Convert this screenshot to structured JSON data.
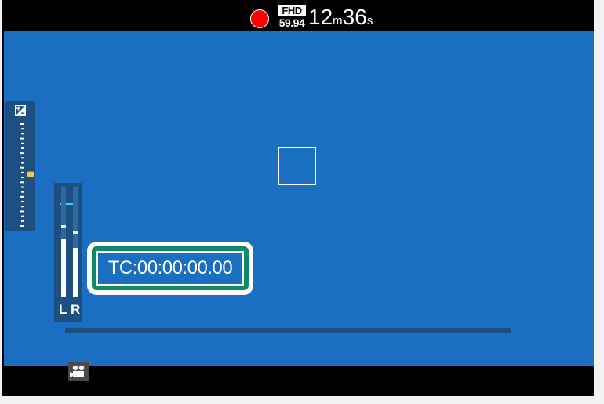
{
  "status": {
    "recording_indicator": "rec-dot",
    "format": "FHD",
    "frame_rate": "59.94",
    "remaining_big": "12",
    "remaining_unit_m": "m",
    "remaining_big_2": "36",
    "remaining_unit_s": "s"
  },
  "timecode": "TC:00:00:00.00",
  "audio": {
    "left_label": "L",
    "right_label": "R",
    "left_level": 0.53,
    "right_level": 0.45,
    "left_peak": 0.63,
    "right_peak": 0.58
  },
  "exposure": {
    "compensation": 0.0
  },
  "colors": {
    "viewfinder": "#1a6fc2",
    "panel": "#1d4f80",
    "rec": "#ff0000",
    "callout_border": "#0e8a6a",
    "meter_accent": "#3ad4e8",
    "exposure_marker": "#f2c84b"
  },
  "icons": {
    "exposure": "exposure-compensation-icon",
    "mode": "movie-camera-icon"
  }
}
